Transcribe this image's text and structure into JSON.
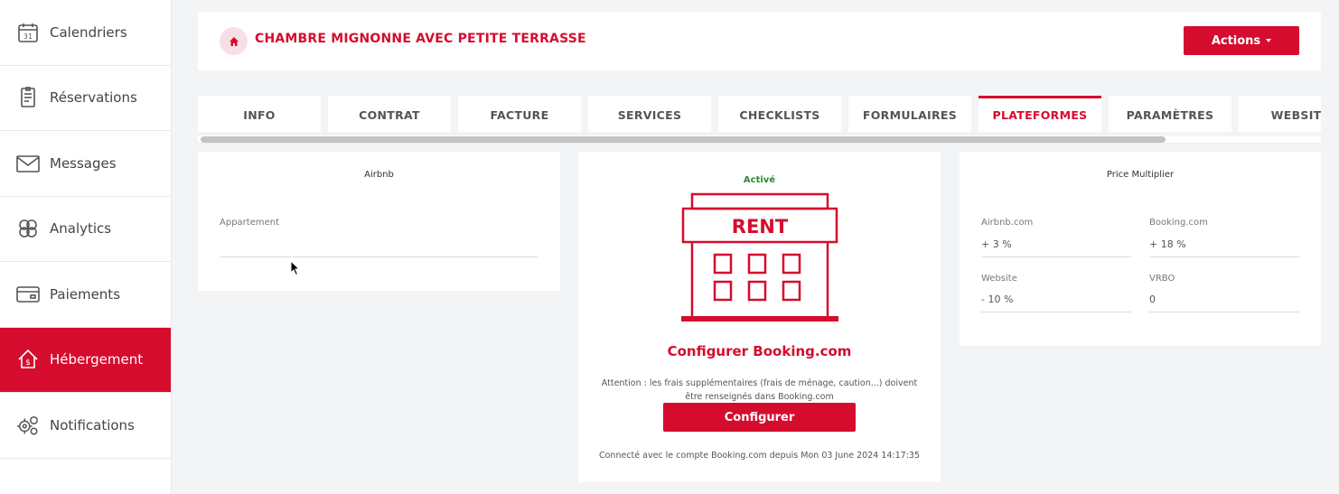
{
  "sidebar": {
    "items": [
      {
        "label": "Calendriers",
        "icon": "calendar-icon",
        "icon_text": "31"
      },
      {
        "label": "Réservations",
        "icon": "reservation-icon"
      },
      {
        "label": "Messages",
        "icon": "envelope-icon"
      },
      {
        "label": "Analytics",
        "icon": "analytics-icon"
      },
      {
        "label": "Paiements",
        "icon": "credit-card-icon"
      },
      {
        "label": "Hébergement",
        "icon": "house-money-icon",
        "active": true
      },
      {
        "label": "Notifications",
        "icon": "gears-icon"
      }
    ]
  },
  "header": {
    "title": "CHAMBRE MIGNONNE AVEC PETITE TERRASSE",
    "actions_label": "Actions"
  },
  "tabs": [
    {
      "label": "INFO"
    },
    {
      "label": "CONTRAT"
    },
    {
      "label": "FACTURE"
    },
    {
      "label": "SERVICES"
    },
    {
      "label": "CHECKLISTS"
    },
    {
      "label": "FORMULAIRES"
    },
    {
      "label": "PLATEFORMES",
      "active": true
    },
    {
      "label": "PARAMÈTRES"
    },
    {
      "label": "WEBSITE"
    }
  ],
  "airbnb": {
    "title": "Airbnb",
    "field_label": "Appartement",
    "field_value": ""
  },
  "booking": {
    "status": "Activé",
    "sign_text": "RENT",
    "configure_title": "Configurer Booking.com",
    "warning": "Attention : les frais supplémentaires (frais de ménage, caution...) doivent être renseignés dans Booking.com",
    "configure_button": "Configurer",
    "connected": "Connecté avec le compte Booking.com depuis Mon 03 June 2024 14:17:35"
  },
  "price_multiplier": {
    "title": "Price Multiplier",
    "fields": [
      {
        "label": "Airbnb.com",
        "value": "+ 3 %"
      },
      {
        "label": "Booking.com",
        "value": "+ 18 %"
      },
      {
        "label": "Website",
        "value": "- 10 %"
      },
      {
        "label": "VRBO",
        "value": "0"
      }
    ]
  },
  "colors": {
    "brand": "#d50c2e",
    "active_status": "#2e8b2e"
  }
}
